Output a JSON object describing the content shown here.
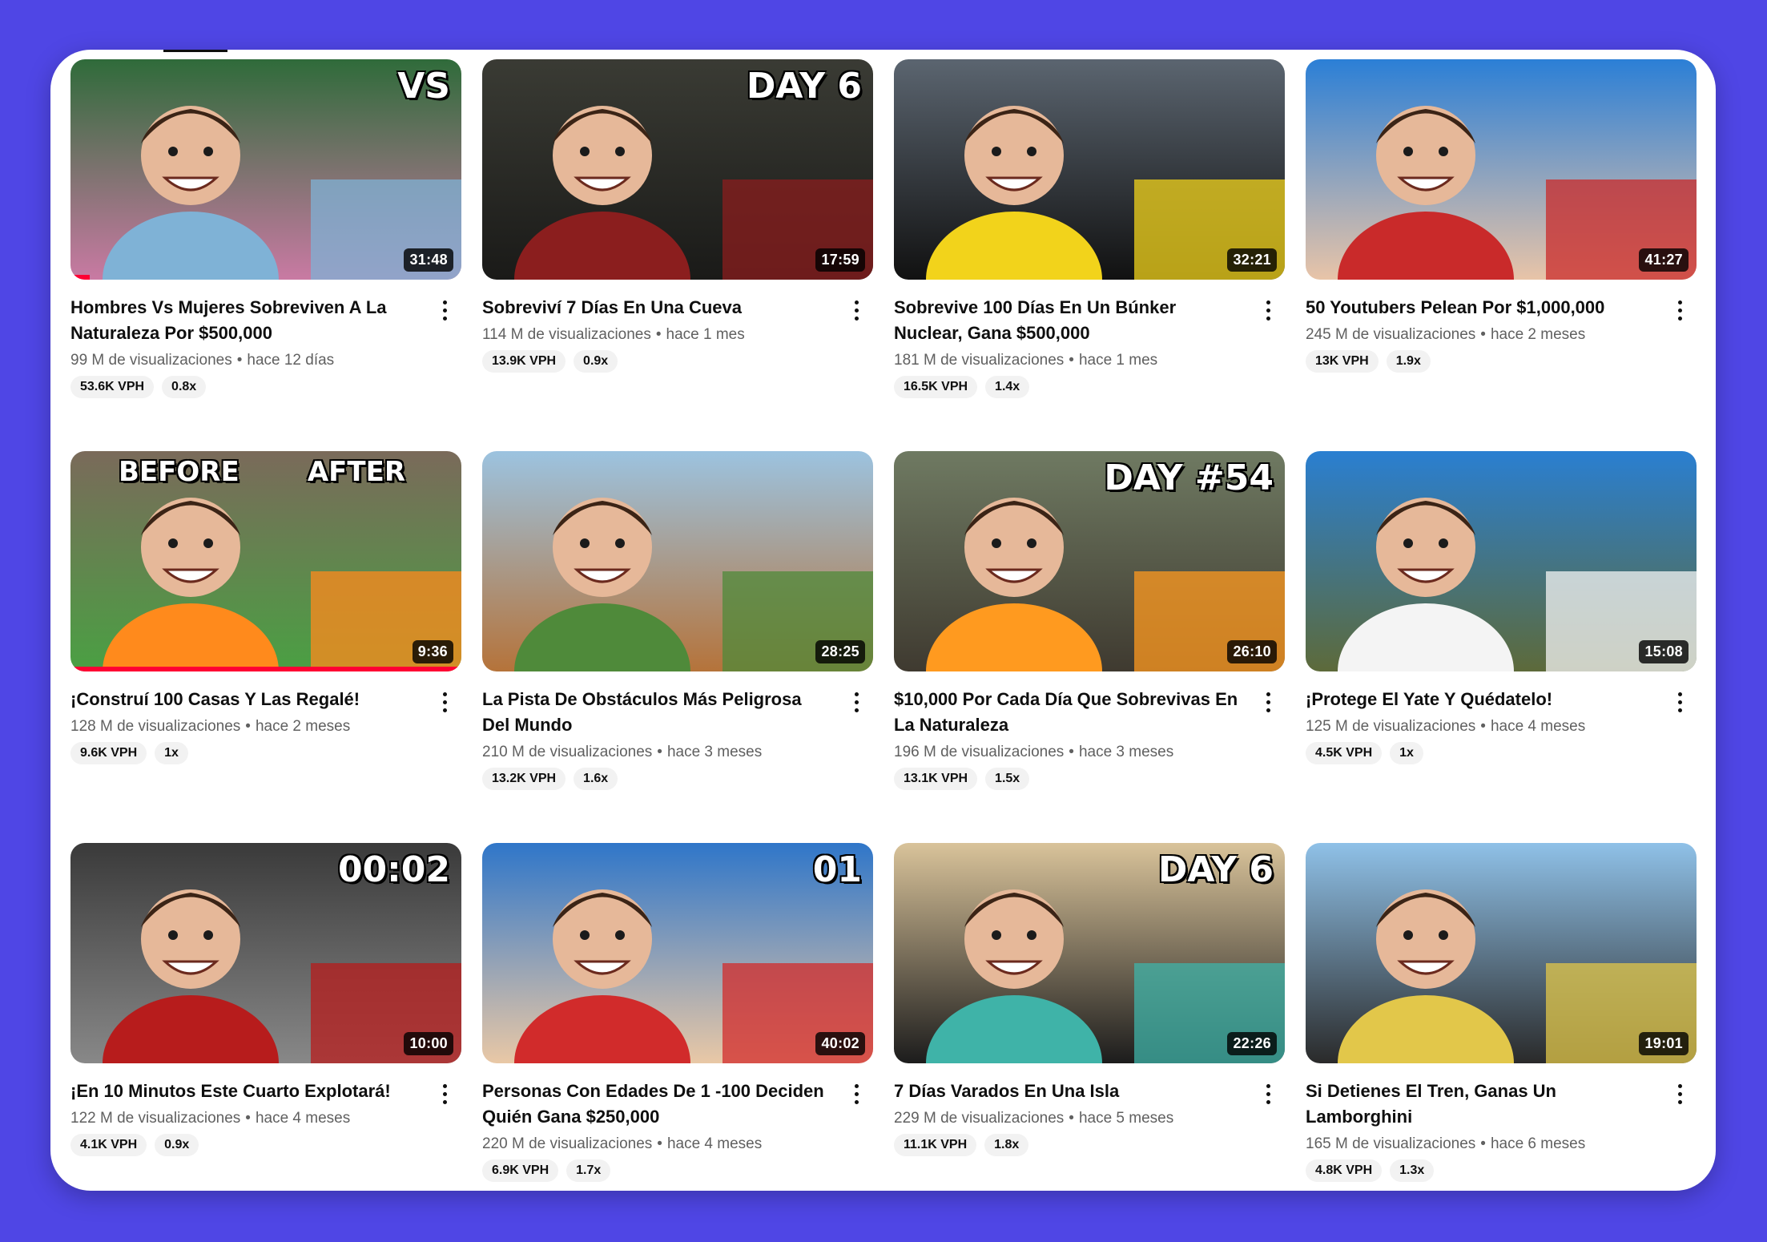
{
  "colors": {
    "background": "#4f46e5",
    "card": "#ffffff",
    "progress": "#ff0033"
  },
  "menu_icon": "more-vert-icon",
  "videos": [
    {
      "title": "Hombres Vs Mujeres Sobreviven A La Naturaleza Por $500,000",
      "views": "99 M de visualizaciones",
      "age": "hace 12 días",
      "duration": "31:48",
      "vph": "53.6K VPH",
      "ratio": "0.8x",
      "watched": 0.05,
      "overlay": "VS",
      "thumb_colors": [
        "#2f6b3a",
        "#7fb2d6",
        "#c97aa3"
      ]
    },
    {
      "title": "Sobreviví 7 Días En Una Cueva",
      "views": "114 M de visualizaciones",
      "age": "hace 1 mes",
      "duration": "17:59",
      "vph": "13.9K VPH",
      "ratio": "0.9x",
      "watched": 0,
      "overlay": "DAY 6",
      "thumb_colors": [
        "#3a3b34",
        "#8b1e1e",
        "#1a1a18"
      ]
    },
    {
      "title": "Sobrevive 100 Días En Un Búnker Nuclear, Gana $500,000",
      "views": "181 M de visualizaciones",
      "age": "hace 1 mes",
      "duration": "32:21",
      "vph": "16.5K VPH",
      "ratio": "1.4x",
      "watched": 0,
      "overlay": "",
      "thumb_colors": [
        "#5b6570",
        "#f2d31b",
        "#111111"
      ]
    },
    {
      "title": "50 Youtubers Pelean Por $1,000,000",
      "views": "245 M de visualizaciones",
      "age": "hace 2 meses",
      "duration": "41:27",
      "vph": "13K VPH",
      "ratio": "1.9x",
      "watched": 0,
      "overlay": "",
      "thumb_colors": [
        "#2b7fd6",
        "#c92a2a",
        "#e8c4a8"
      ]
    },
    {
      "title": "¡Construí 100 Casas Y Las Regalé!",
      "views": "128 M de visualizaciones",
      "age": "hace 2 meses",
      "duration": "9:36",
      "vph": "9.6K VPH",
      "ratio": "1x",
      "watched": 1,
      "overlay": "BEFORE|AFTER",
      "thumb_colors": [
        "#7a6a5a",
        "#ff8a1c",
        "#4aa043"
      ]
    },
    {
      "title": "La Pista De Obstáculos Más Peligrosa Del Mundo",
      "views": "210 M de visualizaciones",
      "age": "hace 3 meses",
      "duration": "28:25",
      "vph": "13.2K VPH",
      "ratio": "1.6x",
      "watched": 0,
      "overlay": "",
      "thumb_colors": [
        "#9cc3e0",
        "#4f8a3a",
        "#b5733a"
      ]
    },
    {
      "title": "$10,000 Por Cada Día Que Sobrevivas En La Naturaleza",
      "views": "196 M de visualizaciones",
      "age": "hace 3 meses",
      "duration": "26:10",
      "vph": "13.1K VPH",
      "ratio": "1.5x",
      "watched": 0,
      "overlay": "DAY #54",
      "thumb_colors": [
        "#6f7a62",
        "#ff9a1f",
        "#3f3a30"
      ]
    },
    {
      "title": "¡Protege El Yate Y Quédatelo!",
      "views": "125 M de visualizaciones",
      "age": "hace 4 meses",
      "duration": "15:08",
      "vph": "4.5K VPH",
      "ratio": "1x",
      "watched": 0,
      "overlay": "",
      "thumb_colors": [
        "#2a7fd1",
        "#f4f4f4",
        "#5d6a3a"
      ]
    },
    {
      "title": "¡En 10 Minutos Este Cuarto Explotará!",
      "views": "122 M de visualizaciones",
      "age": "hace 4 meses",
      "duration": "10:00",
      "vph": "4.1K VPH",
      "ratio": "0.9x",
      "watched": 0,
      "overlay": "00:02",
      "thumb_colors": [
        "#3a3a3a",
        "#b71c1c",
        "#888888"
      ]
    },
    {
      "title": "Personas Con Edades De 1 -100 Deciden Quién Gana $250,000",
      "views": "220 M de visualizaciones",
      "age": "hace 4 meses",
      "duration": "40:02",
      "vph": "6.9K VPH",
      "ratio": "1.7x",
      "watched": 0,
      "overlay": "01",
      "thumb_colors": [
        "#2f76c9",
        "#d12b2b",
        "#e9c8a6"
      ]
    },
    {
      "title": "7 Días Varados En Una Isla",
      "views": "229 M de visualizaciones",
      "age": "hace 5 meses",
      "duration": "22:26",
      "vph": "11.1K VPH",
      "ratio": "1.8x",
      "watched": 0,
      "overlay": "DAY 6",
      "thumb_colors": [
        "#d9c39a",
        "#3fb3a8",
        "#1c1c1c"
      ]
    },
    {
      "title": "Si Detienes El Tren, Ganas Un Lamborghini",
      "views": "165 M de visualizaciones",
      "age": "hace 6 meses",
      "duration": "19:01",
      "vph": "4.8K VPH",
      "ratio": "1.3x",
      "watched": 0,
      "overlay": "",
      "thumb_colors": [
        "#8fc1e8",
        "#e2c74a",
        "#2a2a2a"
      ]
    }
  ]
}
